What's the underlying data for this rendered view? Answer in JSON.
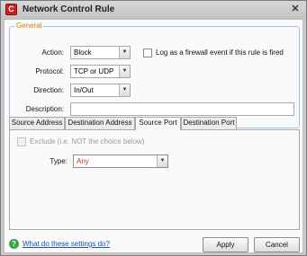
{
  "window": {
    "title": "Network Control Rule"
  },
  "general": {
    "legend": "General",
    "action": {
      "label": "Action:",
      "value": "Block"
    },
    "log_checkbox": {
      "label": "Log as a firewall event if this rule is fired",
      "checked": false
    },
    "protocol": {
      "label": "Protocol:",
      "value": "TCP or UDP"
    },
    "direction": {
      "label": "Direction:",
      "value": "In/Out"
    },
    "description": {
      "label": "Description:",
      "value": ""
    }
  },
  "tabs": [
    "Source Address",
    "Destination Address",
    "Source Port",
    "Destination Port"
  ],
  "active_tab": "Source Port",
  "port_panel": {
    "exclude": {
      "label": "Exclude (i.e. NOT the choice below)",
      "checked": false,
      "enabled": false
    },
    "type": {
      "label": "Type:",
      "value": "Any"
    }
  },
  "footer": {
    "help_link": "What do these settings do?",
    "apply": "Apply",
    "cancel": "Cancel"
  },
  "colors": {
    "legend": "#e07800",
    "group_border": "#9fc3e6",
    "link": "#1a4fb3",
    "type_text": "#c0392b"
  }
}
